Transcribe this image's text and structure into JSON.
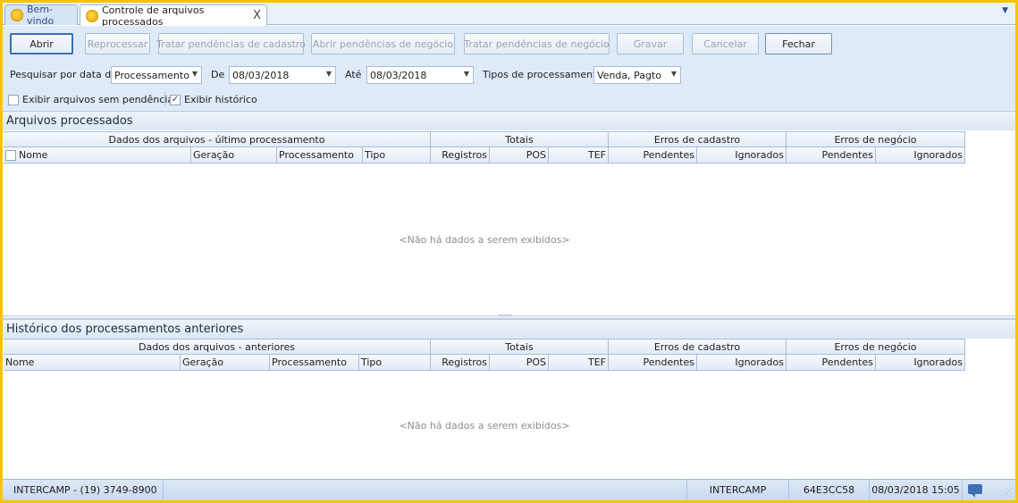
{
  "tabs": [
    {
      "label": "Bem-vindo"
    },
    {
      "label": "Controle de arquivos processados",
      "close": "X"
    }
  ],
  "toolbar": {
    "abrir": "Abrir",
    "reprocessar": "Reprocessar",
    "tratar_cadastro": "Tratar pendências de cadastro",
    "abrir_negocio": "Abrir pendências de negócio",
    "tratar_negocio": "Tratar pendências de negócio",
    "gravar": "Gravar",
    "cancelar": "Cancelar",
    "fechar": "Fechar"
  },
  "filters": {
    "pesquisar_label": "Pesquisar por data de",
    "pesquisar_value": "Processamento",
    "de_label": "De",
    "de_value": "08/03/2018",
    "ate_label": "Até",
    "ate_value": "08/03/2018",
    "tipos_label": "Tipos de processamento",
    "tipos_value": "Venda, Pagto",
    "exibir_sem_pendencias": "Exibir arquivos sem pendências",
    "exibir_sem_pendencias_checked": false,
    "exibir_historico": "Exibir histórico",
    "exibir_historico_checked": true
  },
  "processed": {
    "title": "Arquivos processados",
    "bands": [
      "Dados dos arquivos - último processamento",
      "Totais",
      "Erros de cadastro",
      "Erros de negócio"
    ],
    "columns": [
      "Nome",
      "Geração",
      "Processamento",
      "Tipo",
      "Registros",
      "POS",
      "TEF",
      "Pendentes",
      "Ignorados",
      "Pendentes",
      "Ignorados"
    ],
    "empty": "<Não há dados a serem exibidos>"
  },
  "history": {
    "title": "Histórico dos processamentos anteriores",
    "bands": [
      "Dados dos arquivos - anteriores",
      "Totais",
      "Erros de cadastro",
      "Erros de negócio"
    ],
    "columns": [
      "Nome",
      "Geração",
      "Processamento",
      "Tipo",
      "Registros",
      "POS",
      "TEF",
      "Pendentes",
      "Ignorados",
      "Pendentes",
      "Ignorados"
    ],
    "empty": "<Não há dados a serem exibidos>"
  },
  "status": {
    "company": "INTERCAMP - (19) 3749-8900",
    "user": "INTERCAMP",
    "code": "64E3CC58",
    "datetime": "08/03/2018 15:05"
  }
}
